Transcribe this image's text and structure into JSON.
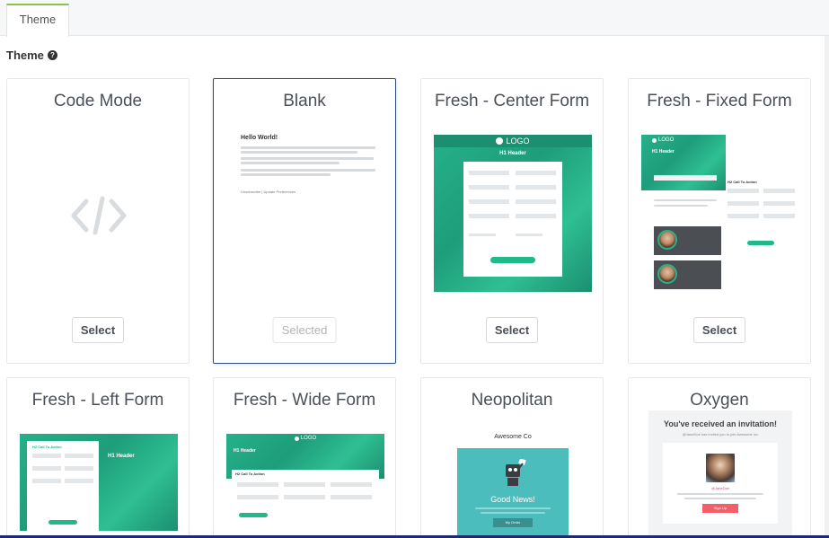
{
  "tabs": [
    {
      "label": "Theme",
      "active": true
    }
  ],
  "section": {
    "title": "Theme",
    "help_icon": "question-circle-icon"
  },
  "themes": [
    {
      "name": "Code Mode",
      "button": "Select",
      "state": "normal"
    },
    {
      "name": "Blank",
      "button": "Selected",
      "state": "selected"
    },
    {
      "name": "Fresh - Center Form",
      "button": "Select",
      "state": "normal"
    },
    {
      "name": "Fresh - Fixed Form",
      "button": "Select",
      "state": "normal"
    },
    {
      "name": "Fresh - Left Form",
      "button": "",
      "state": "normal"
    },
    {
      "name": "Fresh - Wide Form",
      "button": "",
      "state": "normal"
    },
    {
      "name": "Neopolitan",
      "button": "",
      "state": "normal"
    },
    {
      "name": "Oxygen",
      "button": "",
      "state": "normal"
    }
  ],
  "previews": {
    "blank": {
      "heading": "Hello World!",
      "footer": "Unsubscribe | Update Preferences"
    },
    "logo_text": "LOGO",
    "h1_header": "H1 Header",
    "call_to_action": "H2 Call To Action",
    "neopolitan": {
      "company": "Awesome Co",
      "headline": "Good News!",
      "button": "My Order"
    },
    "oxygen": {
      "headline": "You've received an invitation!",
      "sub": "@JaneDoe has invited you to join Awesome Inc",
      "name": "@JaneDoe",
      "button": "Sign Up"
    }
  },
  "colors": {
    "accent": "#8bc34a",
    "selected_border": "#2c4a80",
    "theme_green": "#25b18a"
  }
}
